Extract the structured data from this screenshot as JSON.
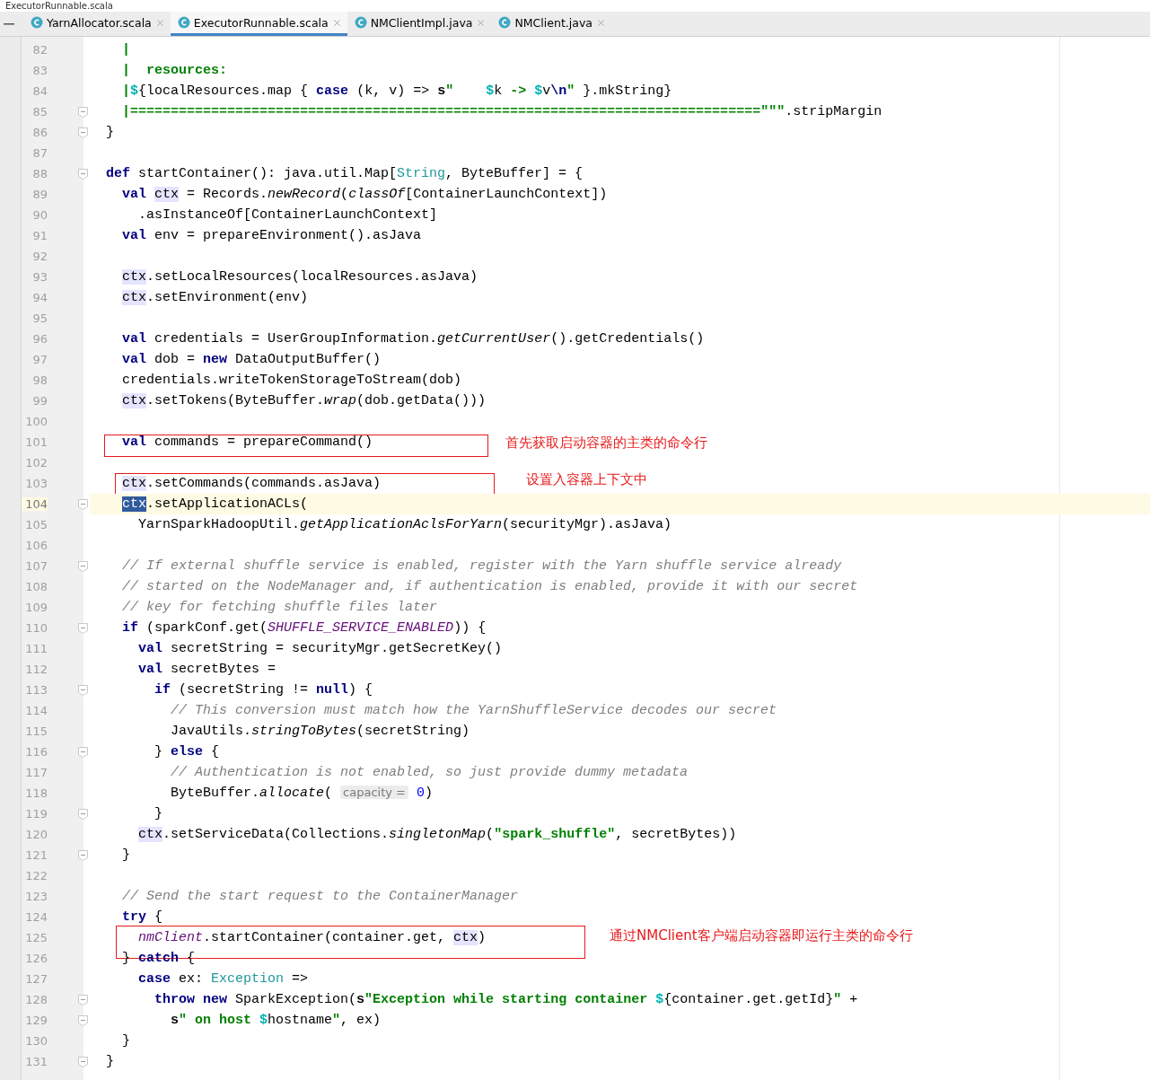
{
  "window": {
    "title": "ExecutorRunnable.scala"
  },
  "tabs": [
    {
      "label": "YarnAllocator.scala",
      "selected": false
    },
    {
      "label": "ExecutorRunnable.scala",
      "selected": true
    },
    {
      "label": "NMClientImpl.java",
      "selected": false
    },
    {
      "label": "NMClient.java",
      "selected": false
    }
  ],
  "lines": [
    {
      "number": "82",
      "fold": false,
      "current": false,
      "tokens": [
        {
          "kind": "string",
          "text": "  |"
        }
      ]
    },
    {
      "number": "83",
      "fold": false,
      "current": false,
      "tokens": [
        {
          "kind": "string",
          "text": "  |  resources:"
        }
      ]
    },
    {
      "number": "84",
      "fold": false,
      "current": false,
      "tokens": [
        {
          "kind": "string",
          "text": "  |"
        },
        {
          "kind": "interp",
          "text": "$"
        },
        {
          "kind": "plain",
          "text": "{localResources.map { "
        },
        {
          "kind": "keyword",
          "text": "case"
        },
        {
          "kind": "plain",
          "text": " (k, v) => "
        },
        {
          "kind": "bold",
          "text": "s"
        },
        {
          "kind": "string",
          "text": "\"    "
        },
        {
          "kind": "interp",
          "text": "$"
        },
        {
          "kind": "plain",
          "text": "k "
        },
        {
          "kind": "string",
          "text": "-> "
        },
        {
          "kind": "interp",
          "text": "$"
        },
        {
          "kind": "plain",
          "text": "v"
        },
        {
          "kind": "escape",
          "text": "\\n"
        },
        {
          "kind": "string",
          "text": "\""
        },
        {
          "kind": "plain",
          "text": " }.mkString}"
        }
      ]
    },
    {
      "number": "85",
      "fold": true,
      "current": false,
      "tokens": [
        {
          "kind": "string",
          "text": "  |==============================================================================\"\"\""
        },
        {
          "kind": "plain",
          "text": ".stripMargin"
        }
      ]
    },
    {
      "number": "86",
      "fold": true,
      "current": false,
      "tokens": [
        {
          "kind": "plain",
          "text": "}"
        }
      ]
    },
    {
      "number": "87",
      "fold": false,
      "current": false
    },
    {
      "number": "88",
      "fold": true,
      "current": false,
      "tokens": [
        {
          "kind": "keyword",
          "text": "def"
        },
        {
          "kind": "plain",
          "text": " startContainer(): java.util.Map["
        },
        {
          "kind": "type",
          "text": "String"
        },
        {
          "kind": "plain",
          "text": ", ByteBuffer] = {"
        }
      ]
    },
    {
      "number": "89",
      "fold": false,
      "current": false,
      "tokens": [
        {
          "kind": "keyword",
          "text": "  val"
        },
        {
          "kind": "usage",
          "text": " ctx"
        },
        {
          "kind": "plain",
          "text": " = Records."
        },
        {
          "kind": "method",
          "text": "newRecord"
        },
        {
          "kind": "plain",
          "text": "("
        },
        {
          "kind": "method",
          "text": "classOf"
        },
        {
          "kind": "plain",
          "text": "[ContainerLaunchContext])"
        }
      ]
    },
    {
      "number": "90",
      "fold": false,
      "current": false,
      "tokens": [
        {
          "kind": "plain",
          "text": "    .asInstanceOf[ContainerLaunchContext]"
        }
      ]
    },
    {
      "number": "91",
      "fold": false,
      "current": false,
      "tokens": [
        {
          "kind": "keyword",
          "text": "  val"
        },
        {
          "kind": "plain",
          "text": " env = prepareEnvironment().asJava"
        }
      ]
    },
    {
      "number": "92",
      "fold": false,
      "current": false
    },
    {
      "number": "93",
      "fold": false,
      "current": false,
      "tokens": [
        {
          "kind": "usage",
          "text": "  ctx"
        },
        {
          "kind": "plain",
          "text": ".setLocalResources(localResources.asJava)"
        }
      ]
    },
    {
      "number": "94",
      "fold": false,
      "current": false,
      "tokens": [
        {
          "kind": "usage",
          "text": "  ctx"
        },
        {
          "kind": "plain",
          "text": ".setEnvironment(env)"
        }
      ]
    },
    {
      "number": "95",
      "fold": false,
      "current": false
    },
    {
      "number": "96",
      "fold": false,
      "current": false,
      "tokens": [
        {
          "kind": "keyword",
          "text": "  val"
        },
        {
          "kind": "plain",
          "text": " credentials = UserGroupInformation."
        },
        {
          "kind": "method",
          "text": "getCurrentUser"
        },
        {
          "kind": "plain",
          "text": "().getCredentials()"
        }
      ]
    },
    {
      "number": "97",
      "fold": false,
      "current": false,
      "tokens": [
        {
          "kind": "keyword",
          "text": "  val"
        },
        {
          "kind": "plain",
          "text": " dob = "
        },
        {
          "kind": "keyword",
          "text": "new"
        },
        {
          "kind": "plain",
          "text": " DataOutputBuffer()"
        }
      ]
    },
    {
      "number": "98",
      "fold": false,
      "current": false,
      "tokens": [
        {
          "kind": "plain",
          "text": "  credentials.writeTokenStorageToStream(dob)"
        }
      ]
    },
    {
      "number": "99",
      "fold": false,
      "current": false,
      "tokens": [
        {
          "kind": "usage",
          "text": "  ctx"
        },
        {
          "kind": "plain",
          "text": ".setTokens(ByteBuffer."
        },
        {
          "kind": "method",
          "text": "wrap"
        },
        {
          "kind": "plain",
          "text": "(dob.getData()))"
        }
      ]
    },
    {
      "number": "100",
      "fold": false,
      "current": false
    },
    {
      "number": "101",
      "fold": false,
      "current": false,
      "note": "首先获取启动容器的主类的命令行",
      "tokens": [
        {
          "kind": "keyword",
          "text": "  val"
        },
        {
          "kind": "plain",
          "text": " commands = prepareCommand()"
        }
      ]
    },
    {
      "number": "102",
      "fold": false,
      "current": false
    },
    {
      "number": "103",
      "fold": false,
      "current": false,
      "note": "设置入容器上下文中",
      "tokens": [
        {
          "kind": "usage",
          "text": "  ctx"
        },
        {
          "kind": "plain",
          "text": ".setCommands(commands.asJava)"
        }
      ]
    },
    {
      "number": "104",
      "fold": true,
      "current": true,
      "tokens": [
        {
          "kind": "selected",
          "text": "  ctx"
        },
        {
          "kind": "plain",
          "text": ".setApplicationACLs("
        }
      ]
    },
    {
      "number": "105",
      "fold": false,
      "current": false,
      "tokens": [
        {
          "kind": "plain",
          "text": "    YarnSparkHadoopUtil."
        },
        {
          "kind": "method",
          "text": "getApplicationAclsForYarn"
        },
        {
          "kind": "plain",
          "text": "(securityMgr).asJava)"
        }
      ]
    },
    {
      "number": "106",
      "fold": false,
      "current": false
    },
    {
      "number": "107",
      "fold": true,
      "current": false,
      "tokens": [
        {
          "kind": "comment",
          "text": "  // If external shuffle service is enabled, register with the Yarn shuffle service already"
        }
      ]
    },
    {
      "number": "108",
      "fold": false,
      "current": false,
      "tokens": [
        {
          "kind": "comment",
          "text": "  // started on the NodeManager and, if authentication is enabled, provide it with our secret"
        }
      ]
    },
    {
      "number": "109",
      "fold": false,
      "current": false,
      "tokens": [
        {
          "kind": "comment",
          "text": "  // key for fetching shuffle files later"
        }
      ]
    },
    {
      "number": "110",
      "fold": true,
      "current": false,
      "tokens": [
        {
          "kind": "keyword",
          "text": "  if"
        },
        {
          "kind": "plain",
          "text": " (sparkConf.get("
        },
        {
          "kind": "constant",
          "text": "SHUFFLE_SERVICE_ENABLED"
        },
        {
          "kind": "plain",
          "text": ")) {"
        }
      ]
    },
    {
      "number": "111",
      "fold": false,
      "current": false,
      "tokens": [
        {
          "kind": "keyword",
          "text": "    val"
        },
        {
          "kind": "plain",
          "text": " secretString = securityMgr.getSecretKey()"
        }
      ]
    },
    {
      "number": "112",
      "fold": false,
      "current": false,
      "tokens": [
        {
          "kind": "keyword",
          "text": "    val"
        },
        {
          "kind": "plain",
          "text": " secretBytes ="
        }
      ]
    },
    {
      "number": "113",
      "fold": true,
      "current": false,
      "tokens": [
        {
          "kind": "keyword",
          "text": "      if"
        },
        {
          "kind": "plain",
          "text": " (secretString != "
        },
        {
          "kind": "keyword",
          "text": "null"
        },
        {
          "kind": "plain",
          "text": ") {"
        }
      ]
    },
    {
      "number": "114",
      "fold": false,
      "current": false,
      "tokens": [
        {
          "kind": "comment",
          "text": "        // This conversion must match how the YarnShuffleService decodes our secret"
        }
      ]
    },
    {
      "number": "115",
      "fold": false,
      "current": false,
      "tokens": [
        {
          "kind": "plain",
          "text": "        JavaUtils."
        },
        {
          "kind": "method",
          "text": "stringToBytes"
        },
        {
          "kind": "plain",
          "text": "(secretString)"
        }
      ]
    },
    {
      "number": "116",
      "fold": true,
      "current": false,
      "tokens": [
        {
          "kind": "plain",
          "text": "      } "
        },
        {
          "kind": "keyword",
          "text": "else"
        },
        {
          "kind": "plain",
          "text": " {"
        }
      ]
    },
    {
      "number": "117",
      "fold": false,
      "current": false,
      "tokens": [
        {
          "kind": "comment",
          "text": "        // Authentication is not enabled, so just provide dummy metadata"
        }
      ]
    },
    {
      "number": "118",
      "fold": false,
      "current": false,
      "tokens": [
        {
          "kind": "plain",
          "text": "        ByteBuffer."
        },
        {
          "kind": "method",
          "text": "allocate"
        },
        {
          "kind": "plain",
          "text": "( "
        },
        {
          "kind": "hint",
          "text": "capacity ="
        },
        {
          "kind": "number",
          "text": " 0"
        },
        {
          "kind": "plain",
          "text": ")"
        }
      ]
    },
    {
      "number": "119",
      "fold": true,
      "current": false,
      "tokens": [
        {
          "kind": "plain",
          "text": "      }"
        }
      ]
    },
    {
      "number": "120",
      "fold": false,
      "current": false,
      "tokens": [
        {
          "kind": "usage",
          "text": "    ctx"
        },
        {
          "kind": "plain",
          "text": ".setServiceData(Collections."
        },
        {
          "kind": "method",
          "text": "singletonMap"
        },
        {
          "kind": "plain",
          "text": "("
        },
        {
          "kind": "string",
          "text": "\"spark_shuffle\""
        },
        {
          "kind": "plain",
          "text": ", secretBytes))"
        }
      ]
    },
    {
      "number": "121",
      "fold": true,
      "current": false,
      "tokens": [
        {
          "kind": "plain",
          "text": "  }"
        }
      ]
    },
    {
      "number": "122",
      "fold": false,
      "current": false
    },
    {
      "number": "123",
      "fold": false,
      "current": false,
      "tokens": [
        {
          "kind": "comment",
          "text": "  // Send the start request to the ContainerManager"
        }
      ]
    },
    {
      "number": "124",
      "fold": false,
      "current": false,
      "tokens": [
        {
          "kind": "keyword",
          "text": "  try"
        },
        {
          "kind": "plain",
          "text": " {"
        }
      ]
    },
    {
      "number": "125",
      "fold": false,
      "current": false,
      "note": "通过NMClient客户端启动容器即运行主类的命令行",
      "tokens": [
        {
          "kind": "field",
          "text": "    nmClient"
        },
        {
          "kind": "plain",
          "text": ".startContainer(container.get, "
        },
        {
          "kind": "usage",
          "text": "ctx"
        },
        {
          "kind": "plain",
          "text": ")"
        }
      ]
    },
    {
      "number": "126",
      "fold": false,
      "current": false,
      "tokens": [
        {
          "kind": "plain",
          "text": "  } "
        },
        {
          "kind": "keyword",
          "text": "catch"
        },
        {
          "kind": "plain",
          "text": " {"
        }
      ]
    },
    {
      "number": "127",
      "fold": false,
      "current": false,
      "tokens": [
        {
          "kind": "keyword",
          "text": "    case"
        },
        {
          "kind": "plain",
          "text": " ex: "
        },
        {
          "kind": "type",
          "text": "Exception"
        },
        {
          "kind": "plain",
          "text": " =>"
        }
      ]
    },
    {
      "number": "128",
      "fold": true,
      "current": false,
      "tokens": [
        {
          "kind": "keyword",
          "text": "      throw new"
        },
        {
          "kind": "plain",
          "text": " SparkException("
        },
        {
          "kind": "bold",
          "text": "s"
        },
        {
          "kind": "string",
          "text": "\"Exception while starting container "
        },
        {
          "kind": "interp",
          "text": "$"
        },
        {
          "kind": "plain",
          "text": "{container.get.getId}"
        },
        {
          "kind": "string",
          "text": "\""
        },
        {
          "kind": "plain",
          "text": " +"
        }
      ]
    },
    {
      "number": "129",
      "fold": true,
      "current": false,
      "tokens": [
        {
          "kind": "bold",
          "text": "        s"
        },
        {
          "kind": "string",
          "text": "\" on host "
        },
        {
          "kind": "interp",
          "text": "$"
        },
        {
          "kind": "plain",
          "text": "hostname"
        },
        {
          "kind": "string",
          "text": "\""
        },
        {
          "kind": "plain",
          "text": ", ex)"
        }
      ]
    },
    {
      "number": "130",
      "fold": false,
      "current": false,
      "tokens": [
        {
          "kind": "plain",
          "text": "  }"
        }
      ]
    },
    {
      "number": "131",
      "fold": true,
      "current": false,
      "tokens": [
        {
          "kind": "plain",
          "text": "}"
        }
      ]
    }
  ]
}
